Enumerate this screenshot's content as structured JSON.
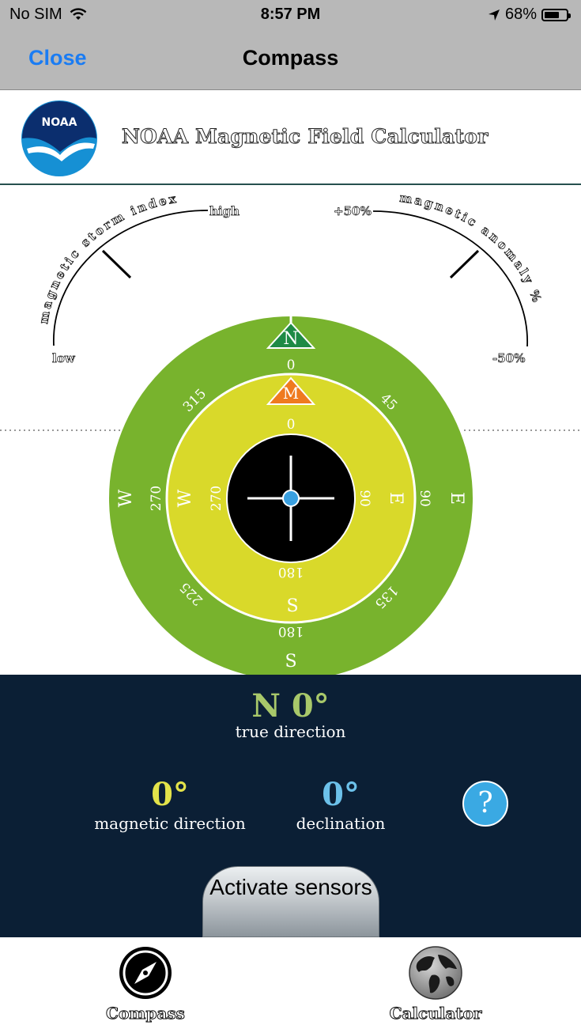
{
  "status_bar": {
    "carrier": "No SIM",
    "time": "8:57 PM",
    "battery": "68%",
    "battery_level": 0.68
  },
  "nav": {
    "close_label": "Close",
    "title": "Compass"
  },
  "header": {
    "logo_text": "NOAA",
    "title": "NOAA Magnetic Field Calculator"
  },
  "gauges": {
    "storm": {
      "label": "magnetic storm index",
      "low": "low",
      "high": "high"
    },
    "anomaly": {
      "label": "magnetic anomaly %",
      "top": "+50%",
      "bottom": "-50%"
    }
  },
  "compass": {
    "outer_ticks": {
      "n": "0",
      "ne": "45",
      "e": "90",
      "se": "135",
      "s": "180",
      "sw": "225",
      "w": "270",
      "nw": "315"
    },
    "outer_dirs": {
      "n": "N",
      "e": "E",
      "s": "S",
      "w": "W"
    },
    "inner_ticks": {
      "n": "0",
      "e": "90",
      "s": "180",
      "w": "270"
    },
    "inner_dirs": {
      "n": "M",
      "e": "E",
      "s": "S",
      "w": "W"
    },
    "colors": {
      "outer": "#78b32d",
      "inner": "#d9d92a",
      "center": "#000000",
      "true_north": "#1e8a45",
      "magnetic_north": "#ef7a1f",
      "dot": "#3aa0e0"
    }
  },
  "readout": {
    "true_direction": "N 0°",
    "true_label": "true direction",
    "magnetic_value": "0°",
    "magnetic_label": "magnetic direction",
    "declination_value": "0°",
    "declination_label": "declination",
    "help": "?"
  },
  "actions": {
    "activate": "Activate sensors"
  },
  "tabs": [
    {
      "label": "Compass",
      "icon": "compass-icon"
    },
    {
      "label": "Calculator",
      "icon": "globe-icon"
    }
  ]
}
